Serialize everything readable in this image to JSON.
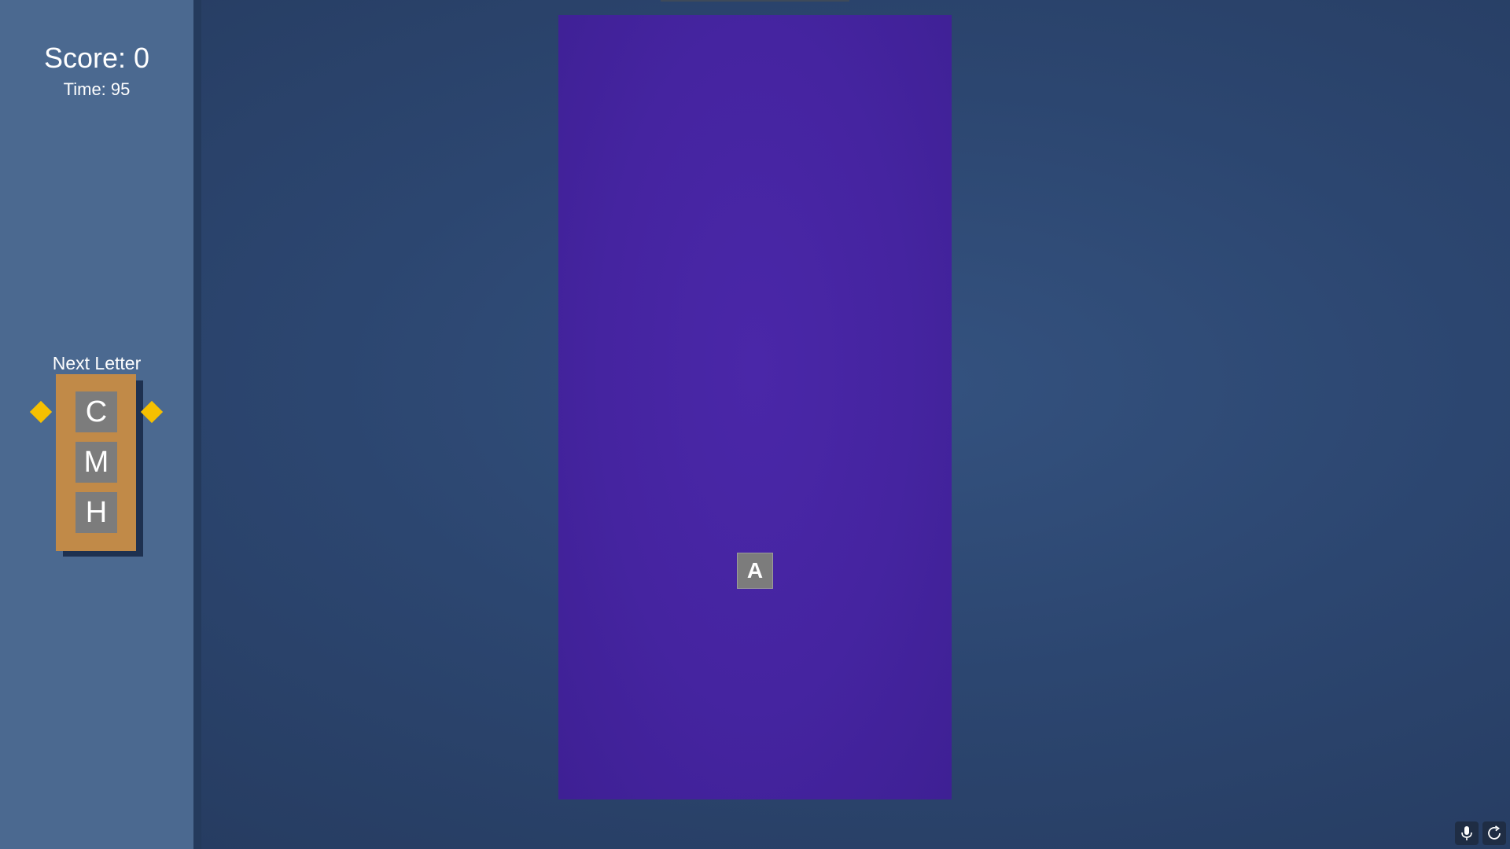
{
  "hud": {
    "score_text": "Score: 0",
    "time_text": "Time: 95"
  },
  "next_panel": {
    "title": "Next Letter",
    "letters": [
      "C",
      "M",
      "H"
    ]
  },
  "board": {
    "falling_letter": "A"
  },
  "icons": {
    "microphone": "microphone-icon",
    "refresh": "refresh-icon"
  },
  "colors": {
    "board": "#4524a0",
    "queue_frame": "#c18a48",
    "tile": "#7c7c7c",
    "marker": "#f6c000"
  }
}
